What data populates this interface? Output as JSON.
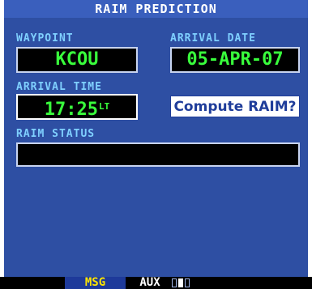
{
  "title": "RAIM PREDICTION",
  "waypoint": {
    "label": "WAYPOINT",
    "value": "KCOU"
  },
  "arrival_date": {
    "label": "ARRIVAL DATE",
    "value": "05-APR-07"
  },
  "arrival_time": {
    "label": "ARRIVAL TIME",
    "value": "17:25",
    "cursor": "LT"
  },
  "compute_button": {
    "label": "Compute RAIM?"
  },
  "raim_status": {
    "label": "RAIM STATUS",
    "value": ""
  },
  "bottom_bar": {
    "msg": "MSG",
    "page_group": "AUX",
    "page_count": 3,
    "active_page": 2
  },
  "colors": {
    "screen_bg": "#2e4fa3",
    "field_text": "#39ff3c",
    "label_text": "#7fd0ff",
    "msg_text": "#ffe600"
  }
}
